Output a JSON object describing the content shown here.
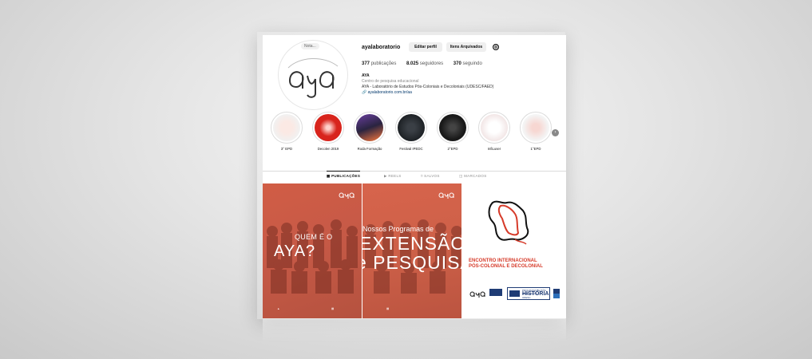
{
  "profile": {
    "note": "Nota...",
    "username": "ayalaboratorio",
    "edit_button": "Editar perfil",
    "archive_button": "Itens Arquivados",
    "stats": {
      "posts_count": "377",
      "posts_label": "publicações",
      "followers_count": "8.025",
      "followers_label": "seguidores",
      "following_count": "370",
      "following_label": "seguindo"
    },
    "bio": {
      "name": "AYA",
      "category": "Centro de pesquisa educacional",
      "description": "AYA - Laboratório de Estudos Pós-Coloniais e Decoloniais (UDESC/FAED)",
      "link": "ayalaboratorio.com.br/aa"
    }
  },
  "highlights": [
    {
      "label": "3° EPD",
      "icon": "highlight-3-epd"
    },
    {
      "label": "Decolen 2019",
      "icon": "highlight-decolen"
    },
    {
      "label": "Roda Formação",
      "icon": "highlight-roda"
    },
    {
      "label": "Festival IPEDC",
      "icon": "highlight-festival"
    },
    {
      "label": "2°EPD",
      "icon": "highlight-2-epd"
    },
    {
      "label": "InfiLuser",
      "icon": "highlight-infiluser"
    },
    {
      "label": "1°EPD",
      "icon": "highlight-1-epd"
    }
  ],
  "tabs": [
    {
      "label": "PUBLICAÇÕES",
      "active": true
    },
    {
      "label": "REELS",
      "active": false
    },
    {
      "label": "SALVOS",
      "active": false
    },
    {
      "label": "MARCADOS",
      "active": false
    }
  ],
  "posts": [
    {
      "line1": "QUEM É O",
      "line2": "AYA?"
    },
    {
      "line1": "Nossos Programas de",
      "line2": "EXTENSÃO",
      "line3": "e PESQUISA"
    },
    {
      "title1": "ENCONTRO INTERNACIONAL",
      "title2": "PÓS-COLONIAL E DECOLONIAL",
      "history_top": "PROGRAMA DE PÓS-GRADUAÇÃO",
      "history_main": "HISTÓRIA",
      "history_bottom": "UDESC"
    }
  ],
  "logo_text": "aya",
  "colors": {
    "accent_red": "#d63b2a",
    "post_overlay": "#cd6048",
    "link_blue": "#00376b"
  }
}
